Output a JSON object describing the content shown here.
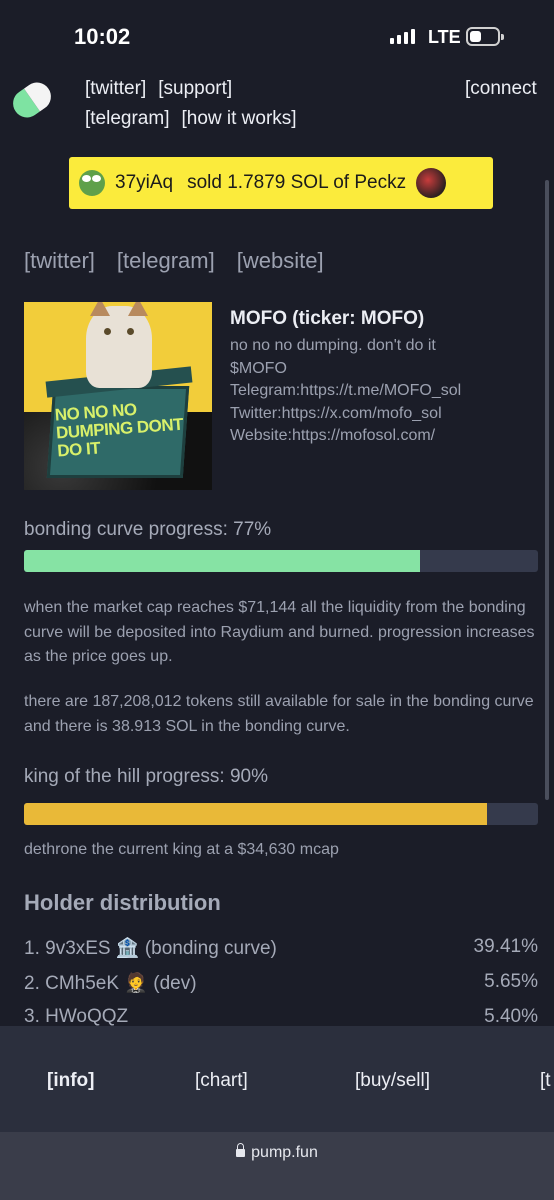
{
  "status": {
    "time": "10:02",
    "network": "LTE"
  },
  "nav": {
    "twitter": "[twitter]",
    "support": "[support]",
    "connect": "[connect",
    "telegram": "[telegram]",
    "how_it_works": "[how it works]"
  },
  "ticker": {
    "user": "37yiAq",
    "action": "sold 1.7879 SOL of Peckz"
  },
  "links": {
    "twitter": "[twitter]",
    "telegram": "[telegram]",
    "website": "[website]"
  },
  "token": {
    "image_text": "NO NO NO DUMPING DONT DO IT",
    "name": "MOFO (ticker: MOFO)",
    "desc1": "no no no dumping. don't do it",
    "desc2": "$MOFO",
    "desc3": "Telegram:https://t.me/MOFO_sol",
    "desc4": "Twitter:https://x.com/mofo_sol",
    "desc5": "Website:https://mofosol.com/"
  },
  "bonding": {
    "label": "bonding curve progress: 77%",
    "progress": 0.77,
    "para1": "when the market cap reaches $71,144 all the liquidity from the bonding curve will be deposited into Raydium and burned. progression increases as the price goes up.",
    "para2": "there are 187,208,012 tokens still available for sale in the bonding curve and there is 38.913 SOL in the bonding curve."
  },
  "king": {
    "label": "king of the hill progress: 90%",
    "progress": 0.9,
    "desc": "dethrone the current king at a $34,630 mcap"
  },
  "holders": {
    "title": "Holder distribution",
    "rows": [
      {
        "label": "1. 9v3xES 🏦 (bonding curve)",
        "pct": "39.41%"
      },
      {
        "label": "2. CMh5eK 🤵 (dev)",
        "pct": "5.65%"
      },
      {
        "label": "3. HWoQQZ",
        "pct": "5.40%"
      }
    ]
  },
  "tabs": {
    "info": "[info]",
    "chart": "[chart]",
    "buysell": "[buy/sell]",
    "trades": "[t"
  },
  "url": "pump.fun",
  "colors": {
    "bonding_fill": "#86e3a4",
    "king_fill": "#e9b938",
    "ticker_bg": "#fbeb3c",
    "background": "#1b1d28"
  }
}
